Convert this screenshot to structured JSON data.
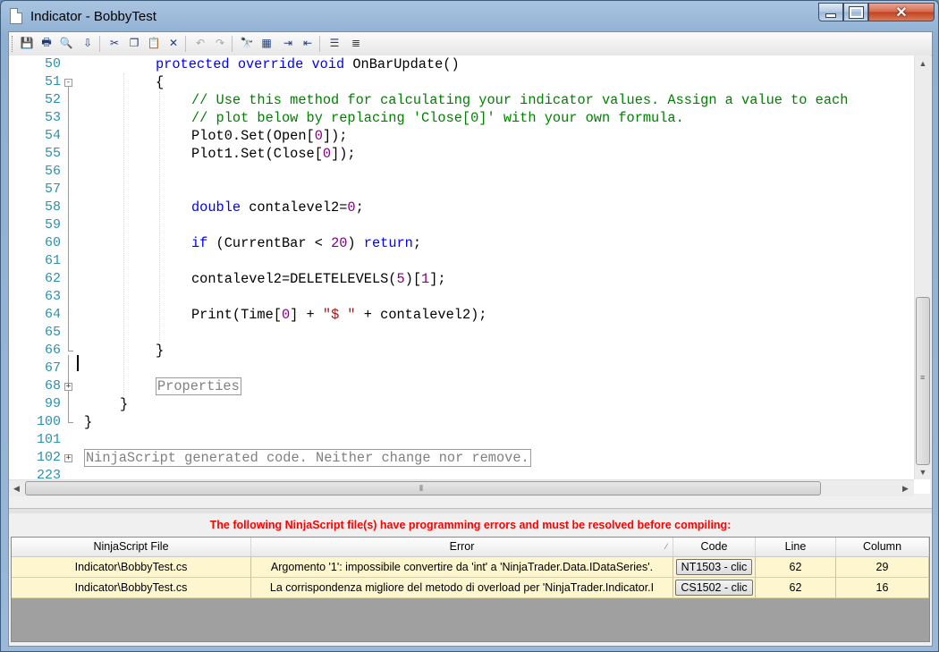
{
  "window": {
    "title": "Indicator - BobbyTest",
    "minimize_glyph": "",
    "maximize_glyph": "",
    "close_glyph": "✕"
  },
  "toolbar": {
    "icons": [
      "save-icon",
      "print-icon",
      "print-preview-icon",
      "export-icon",
      "cut-icon",
      "copy-icon",
      "paste-icon",
      "delete-icon",
      "undo-icon",
      "redo-icon",
      "find-icon",
      "replace-icon",
      "indent-icon",
      "outdent-icon",
      "comment-icon",
      "uncomment-icon"
    ]
  },
  "editor": {
    "lines": [
      {
        "num": "50",
        "indent": 2,
        "html": "<span class=\"kw\">protected</span> <span class=\"kw\">override</span> <span class=\"kw\">void</span> OnBarUpdate()"
      },
      {
        "num": "51",
        "indent": 2,
        "text": "{"
      },
      {
        "num": "52",
        "indent": 3,
        "cm": "// Use this method for calculating your indicator values. Assign a value to each"
      },
      {
        "num": "53",
        "indent": 3,
        "cm": "// plot below by replacing 'Close[0]' with your own formula."
      },
      {
        "num": "54",
        "indent": 3,
        "html": "Plot0.Set(Open[<span class=\"num\">0</span>]);"
      },
      {
        "num": "55",
        "indent": 3,
        "html": "Plot1.Set(Close[<span class=\"num\">0</span>]);"
      },
      {
        "num": "56",
        "indent": 3,
        "text": ""
      },
      {
        "num": "57",
        "indent": 3,
        "text": ""
      },
      {
        "num": "58",
        "indent": 3,
        "html": "<span class=\"kw\">double</span> contalevel2=<span class=\"num\">0</span>;"
      },
      {
        "num": "59",
        "indent": 3,
        "text": ""
      },
      {
        "num": "60",
        "indent": 3,
        "html": "<span class=\"kw\">if</span> (CurrentBar &lt; <span class=\"num\">20</span>) <span class=\"kw\">return</span>;"
      },
      {
        "num": "61",
        "indent": 3,
        "text": ""
      },
      {
        "num": "62",
        "indent": 3,
        "html": "contalevel2=DELETELEVELS(<span class=\"num\">5</span>)[<span class=\"num\">1</span>];"
      },
      {
        "num": "63",
        "indent": 3,
        "text": ""
      },
      {
        "num": "64",
        "indent": 3,
        "html": "Print(Time[<span class=\"num\">0</span>] + <span class=\"str\">\"$ \"</span> + contalevel2);"
      },
      {
        "num": "65",
        "indent": 3,
        "text": ""
      },
      {
        "num": "66",
        "indent": 2,
        "text": "}"
      },
      {
        "num": "67",
        "indent": 0,
        "text": ""
      },
      {
        "num": "68",
        "indent": 2,
        "collapsed": "Properties"
      },
      {
        "num": "99",
        "indent": 1,
        "text": "}"
      },
      {
        "num": "100",
        "indent": 0,
        "text": "}"
      },
      {
        "num": "101",
        "indent": 0,
        "text": ""
      },
      {
        "num": "102",
        "indent": 0,
        "collapsed": "NinjaScript generated code. Neither change nor remove."
      },
      {
        "num": "223",
        "indent": 0,
        "text": ""
      }
    ]
  },
  "errors": {
    "message": "The following NinjaScript file(s) have programming errors and must be resolved before compiling:",
    "columns": [
      "NinjaScript File",
      "Error",
      "Code",
      "Line",
      "Column"
    ],
    "rows": [
      {
        "file": "Indicator\\BobbyTest.cs",
        "error": "Argomento '1': impossibile convertire da 'int' a 'NinjaTrader.Data.IDataSeries'.",
        "code": "NT1503 - clic",
        "line": "62",
        "column": "29"
      },
      {
        "file": "Indicator\\BobbyTest.cs",
        "error": "La corrispondenza migliore del metodo di overload per 'NinjaTrader.Indicator.I",
        "code": "CS1502 - clic",
        "line": "62",
        "column": "16"
      }
    ]
  }
}
